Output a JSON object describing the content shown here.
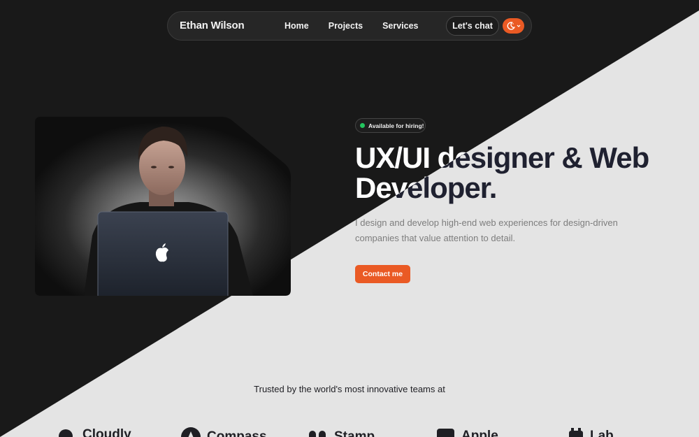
{
  "brand": {
    "name": "Ethan Wilson"
  },
  "nav": {
    "links": [
      "Home",
      "Projects",
      "Services"
    ],
    "chat_label": "Let's chat"
  },
  "hero": {
    "badge": "Available for hiring!",
    "headline_line1": "UX/UI designer & Web",
    "headline_line2": "Developer.",
    "description": "I design and develop high-end web experiences for design-driven companies that value attention to detail.",
    "cta_label": "Contact me"
  },
  "trusted": {
    "heading": "Trusted by the world's most innovative teams at",
    "logos": [
      "Cloudly",
      "Compass",
      "Stamp",
      "Apple",
      "Lab"
    ]
  },
  "colors": {
    "dark": "#191919",
    "light": "#e4e4e4",
    "accent": "#ea5a24",
    "status": "#22c55e",
    "ink": "#1f2130"
  },
  "icons": [
    "moon-icon",
    "chevron-down-icon",
    "apple-logo-icon"
  ]
}
